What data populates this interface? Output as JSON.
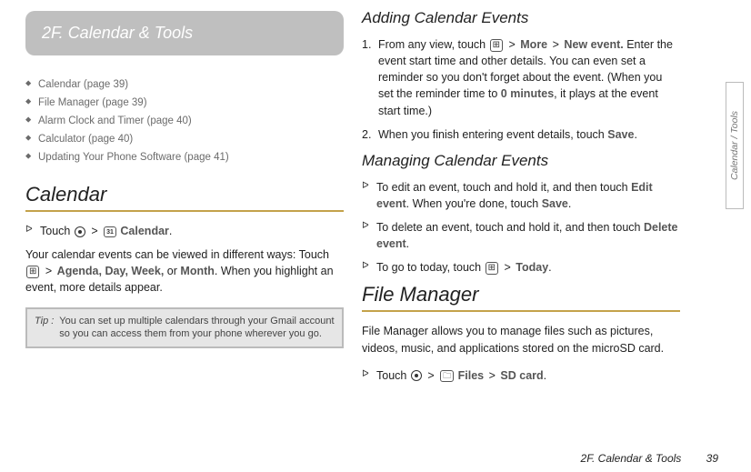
{
  "chapter_tab": "2F.   Calendar & Tools",
  "toc": [
    "Calendar (page 39)",
    "File Manager (page 39)",
    "Alarm Clock and Timer (page 40)",
    "Calculator (page 40)",
    "Updating Your Phone Software (page 41)"
  ],
  "left": {
    "heading": "Calendar",
    "touch_prefix": "Touch",
    "calendar_label": "Calendar",
    "body1a": "Your calendar events can be viewed in different ways: Touch",
    "views": "Agenda, Day, Week,",
    "views_or": "or",
    "views_month": "Month",
    "body1b": ". When you highlight an event, more details appear.",
    "tip_label": "Tip :",
    "tip_text": "You can set up multiple calendars through your Gmail account so you can access them from your phone wherever you go."
  },
  "right": {
    "sub1": "Adding Calendar Events",
    "step1a": "From any view, touch",
    "more": "More",
    "newevent": "New event.",
    "step1b": "Enter the event start time and other details. You can even set a reminder so you don't forget about the event. (When you set the reminder time to",
    "zeromin": "0 minutes",
    "step1c": ", it plays at the event start time.)",
    "step2a": "When you finish entering event details, touch",
    "save": "Save",
    "sub2": "Managing Calendar Events",
    "man1a": "To edit an event, touch and hold it, and then touch",
    "editevent": "Edit event",
    "man1b": ". When you're done, touch",
    "man2a": "To delete an event, touch and hold it, and then touch",
    "deleteevent": "Delete event",
    "man3a": "To go to today, touch",
    "today": "Today",
    "heading2": "File Manager",
    "fm_body": "File Manager allows you to manage files such as pictures, videos, music, and applications stored on the microSD card.",
    "fm_touch": "Touch",
    "files": "Files",
    "sdcard": "SD card"
  },
  "footer": {
    "text": "2F. Calendar & Tools",
    "page": "39"
  },
  "sidetab": "Calendar / Tools",
  "gt": ">",
  "period": "."
}
